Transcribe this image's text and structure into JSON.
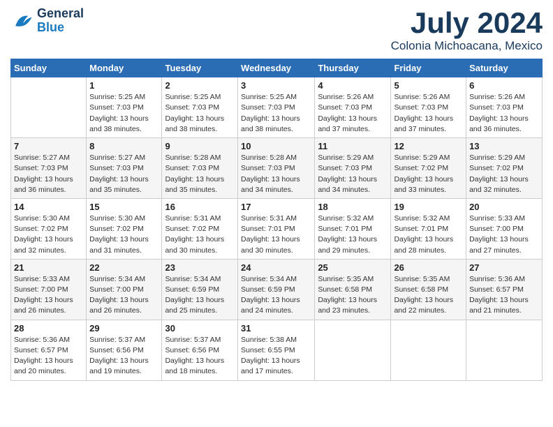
{
  "header": {
    "logo": {
      "general": "General",
      "blue": "Blue"
    },
    "month": "July 2024",
    "location": "Colonia Michoacana, Mexico"
  },
  "days_of_week": [
    "Sunday",
    "Monday",
    "Tuesday",
    "Wednesday",
    "Thursday",
    "Friday",
    "Saturday"
  ],
  "weeks": [
    [
      {
        "day": "",
        "info": ""
      },
      {
        "day": "1",
        "info": "Sunrise: 5:25 AM\nSunset: 7:03 PM\nDaylight: 13 hours\nand 38 minutes."
      },
      {
        "day": "2",
        "info": "Sunrise: 5:25 AM\nSunset: 7:03 PM\nDaylight: 13 hours\nand 38 minutes."
      },
      {
        "day": "3",
        "info": "Sunrise: 5:25 AM\nSunset: 7:03 PM\nDaylight: 13 hours\nand 38 minutes."
      },
      {
        "day": "4",
        "info": "Sunrise: 5:26 AM\nSunset: 7:03 PM\nDaylight: 13 hours\nand 37 minutes."
      },
      {
        "day": "5",
        "info": "Sunrise: 5:26 AM\nSunset: 7:03 PM\nDaylight: 13 hours\nand 37 minutes."
      },
      {
        "day": "6",
        "info": "Sunrise: 5:26 AM\nSunset: 7:03 PM\nDaylight: 13 hours\nand 36 minutes."
      }
    ],
    [
      {
        "day": "7",
        "info": "Sunrise: 5:27 AM\nSunset: 7:03 PM\nDaylight: 13 hours\nand 36 minutes."
      },
      {
        "day": "8",
        "info": "Sunrise: 5:27 AM\nSunset: 7:03 PM\nDaylight: 13 hours\nand 35 minutes."
      },
      {
        "day": "9",
        "info": "Sunrise: 5:28 AM\nSunset: 7:03 PM\nDaylight: 13 hours\nand 35 minutes."
      },
      {
        "day": "10",
        "info": "Sunrise: 5:28 AM\nSunset: 7:03 PM\nDaylight: 13 hours\nand 34 minutes."
      },
      {
        "day": "11",
        "info": "Sunrise: 5:29 AM\nSunset: 7:03 PM\nDaylight: 13 hours\nand 34 minutes."
      },
      {
        "day": "12",
        "info": "Sunrise: 5:29 AM\nSunset: 7:02 PM\nDaylight: 13 hours\nand 33 minutes."
      },
      {
        "day": "13",
        "info": "Sunrise: 5:29 AM\nSunset: 7:02 PM\nDaylight: 13 hours\nand 32 minutes."
      }
    ],
    [
      {
        "day": "14",
        "info": "Sunrise: 5:30 AM\nSunset: 7:02 PM\nDaylight: 13 hours\nand 32 minutes."
      },
      {
        "day": "15",
        "info": "Sunrise: 5:30 AM\nSunset: 7:02 PM\nDaylight: 13 hours\nand 31 minutes."
      },
      {
        "day": "16",
        "info": "Sunrise: 5:31 AM\nSunset: 7:02 PM\nDaylight: 13 hours\nand 30 minutes."
      },
      {
        "day": "17",
        "info": "Sunrise: 5:31 AM\nSunset: 7:01 PM\nDaylight: 13 hours\nand 30 minutes."
      },
      {
        "day": "18",
        "info": "Sunrise: 5:32 AM\nSunset: 7:01 PM\nDaylight: 13 hours\nand 29 minutes."
      },
      {
        "day": "19",
        "info": "Sunrise: 5:32 AM\nSunset: 7:01 PM\nDaylight: 13 hours\nand 28 minutes."
      },
      {
        "day": "20",
        "info": "Sunrise: 5:33 AM\nSunset: 7:00 PM\nDaylight: 13 hours\nand 27 minutes."
      }
    ],
    [
      {
        "day": "21",
        "info": "Sunrise: 5:33 AM\nSunset: 7:00 PM\nDaylight: 13 hours\nand 26 minutes."
      },
      {
        "day": "22",
        "info": "Sunrise: 5:34 AM\nSunset: 7:00 PM\nDaylight: 13 hours\nand 26 minutes."
      },
      {
        "day": "23",
        "info": "Sunrise: 5:34 AM\nSunset: 6:59 PM\nDaylight: 13 hours\nand 25 minutes."
      },
      {
        "day": "24",
        "info": "Sunrise: 5:34 AM\nSunset: 6:59 PM\nDaylight: 13 hours\nand 24 minutes."
      },
      {
        "day": "25",
        "info": "Sunrise: 5:35 AM\nSunset: 6:58 PM\nDaylight: 13 hours\nand 23 minutes."
      },
      {
        "day": "26",
        "info": "Sunrise: 5:35 AM\nSunset: 6:58 PM\nDaylight: 13 hours\nand 22 minutes."
      },
      {
        "day": "27",
        "info": "Sunrise: 5:36 AM\nSunset: 6:57 PM\nDaylight: 13 hours\nand 21 minutes."
      }
    ],
    [
      {
        "day": "28",
        "info": "Sunrise: 5:36 AM\nSunset: 6:57 PM\nDaylight: 13 hours\nand 20 minutes."
      },
      {
        "day": "29",
        "info": "Sunrise: 5:37 AM\nSunset: 6:56 PM\nDaylight: 13 hours\nand 19 minutes."
      },
      {
        "day": "30",
        "info": "Sunrise: 5:37 AM\nSunset: 6:56 PM\nDaylight: 13 hours\nand 18 minutes."
      },
      {
        "day": "31",
        "info": "Sunrise: 5:38 AM\nSunset: 6:55 PM\nDaylight: 13 hours\nand 17 minutes."
      },
      {
        "day": "",
        "info": ""
      },
      {
        "day": "",
        "info": ""
      },
      {
        "day": "",
        "info": ""
      }
    ]
  ]
}
